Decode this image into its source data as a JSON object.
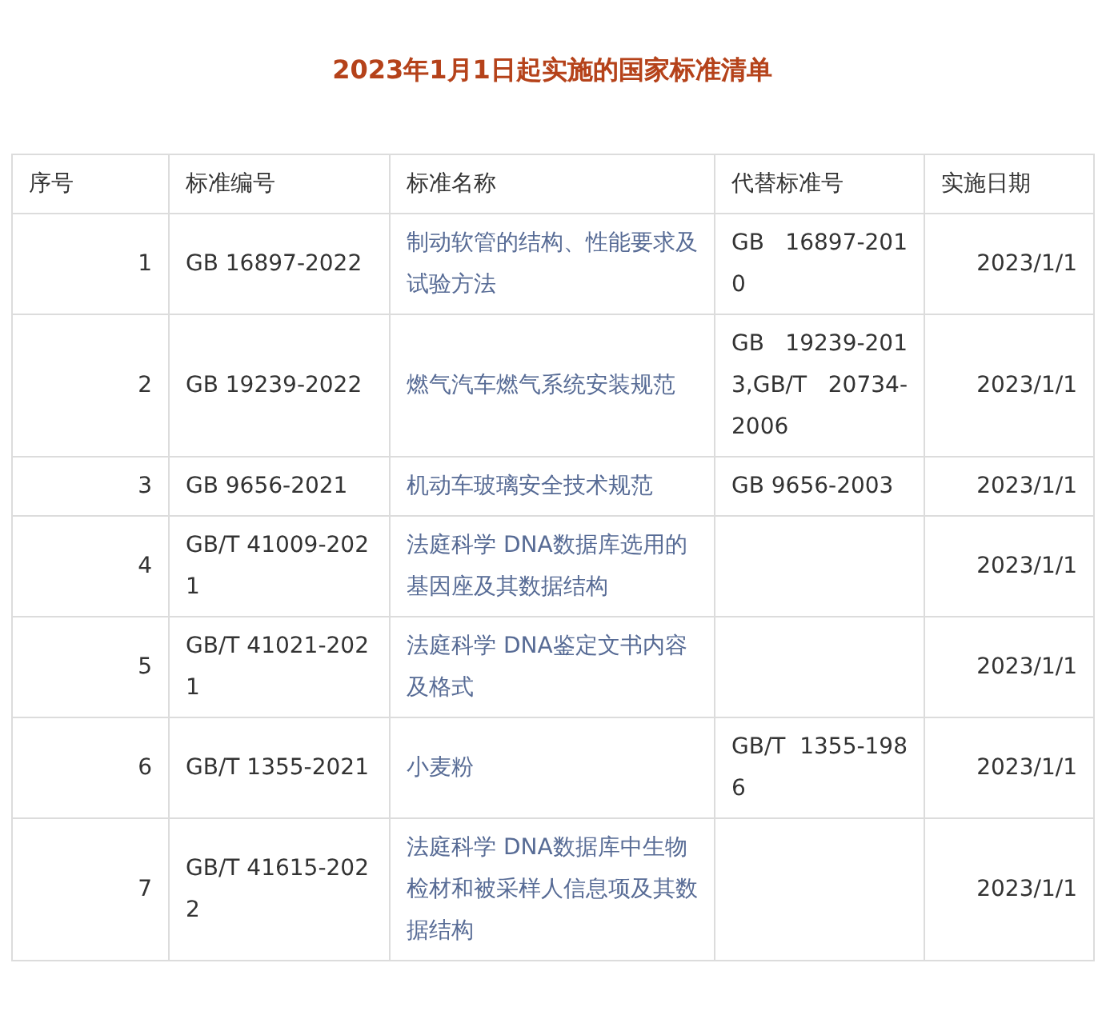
{
  "title": "2023年1月1日起实施的国家标准清单",
  "table": {
    "columns": [
      "序号",
      "标准编号",
      "标准名称",
      "代替标准号",
      "实施日期"
    ],
    "rows": [
      {
        "index": "1",
        "code": "GB 16897-2022",
        "name": "制动软管的结构、性能要求及试验方法",
        "replaces": "GB 16897-2010",
        "date": "2023/1/1"
      },
      {
        "index": "2",
        "code": "GB 19239-2022",
        "name": "燃气汽车燃气系统安装规范",
        "replaces": "GB 19239-2013,GB/T 20734-2006",
        "date": "2023/1/1"
      },
      {
        "index": "3",
        "code": "GB 9656-2021",
        "name": "机动车玻璃安全技术规范",
        "replaces": "GB 9656-2003",
        "date": "2023/1/1"
      },
      {
        "index": "4",
        "code": "GB/T 41009-2021",
        "name": "法庭科学 DNA数据库选用的基因座及其数据结构",
        "date": "2023/1/1"
      },
      {
        "index": "5",
        "code": "GB/T 41021-2021",
        "name": "法庭科学 DNA鉴定文书内容及格式",
        "date": "2023/1/1"
      },
      {
        "index": "6",
        "code": "GB/T 1355-2021",
        "name": "小麦粉",
        "replaces": "GB/T 1355-1986",
        "date": "2023/1/1"
      },
      {
        "index": "7",
        "code": "GB/T 41615-2022",
        "name": "法庭科学 DNA数据库中生物检材和被采样人信息项及其数据结构",
        "date": "2023/1/1"
      }
    ]
  }
}
